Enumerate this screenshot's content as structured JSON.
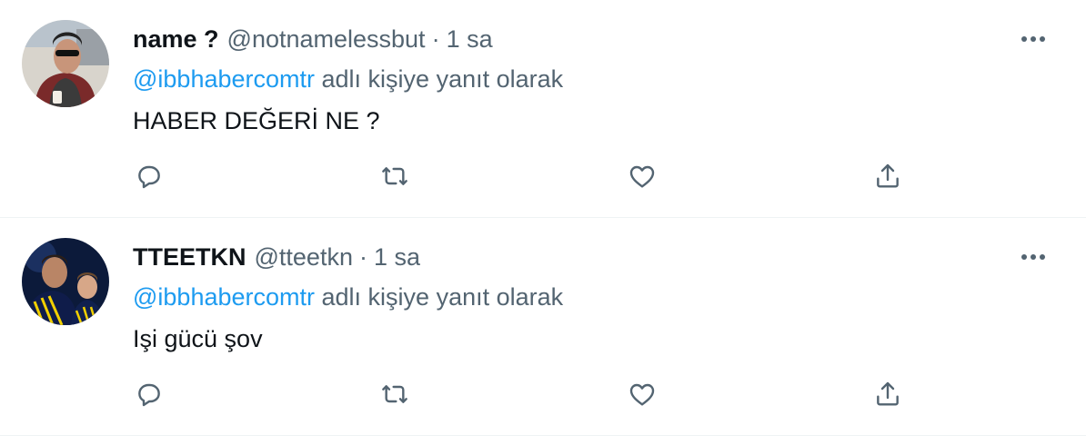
{
  "colors": {
    "text_primary": "#0f1419",
    "text_secondary": "#536471",
    "link": "#1d9bf0",
    "divider": "#eff3f4"
  },
  "tweets": [
    {
      "display_name": "name ?",
      "handle": "@notnamelessbut",
      "separator": "·",
      "time": "1 sa",
      "reply_mention": "@ibbhabercomtr",
      "reply_suffix": "adlı kişiye yanıt olarak",
      "text": "HABER DEĞERİ NE ?",
      "icons": [
        "more-icon",
        "reply-icon",
        "retweet-icon",
        "like-icon",
        "share-icon"
      ]
    },
    {
      "display_name": "TTEETKN",
      "handle": "@tteetkn",
      "separator": "·",
      "time": "1 sa",
      "reply_mention": "@ibbhabercomtr",
      "reply_suffix": "adlı kişiye yanıt olarak",
      "text": "Işi gücü şov",
      "icons": [
        "more-icon",
        "reply-icon",
        "retweet-icon",
        "like-icon",
        "share-icon"
      ]
    }
  ]
}
